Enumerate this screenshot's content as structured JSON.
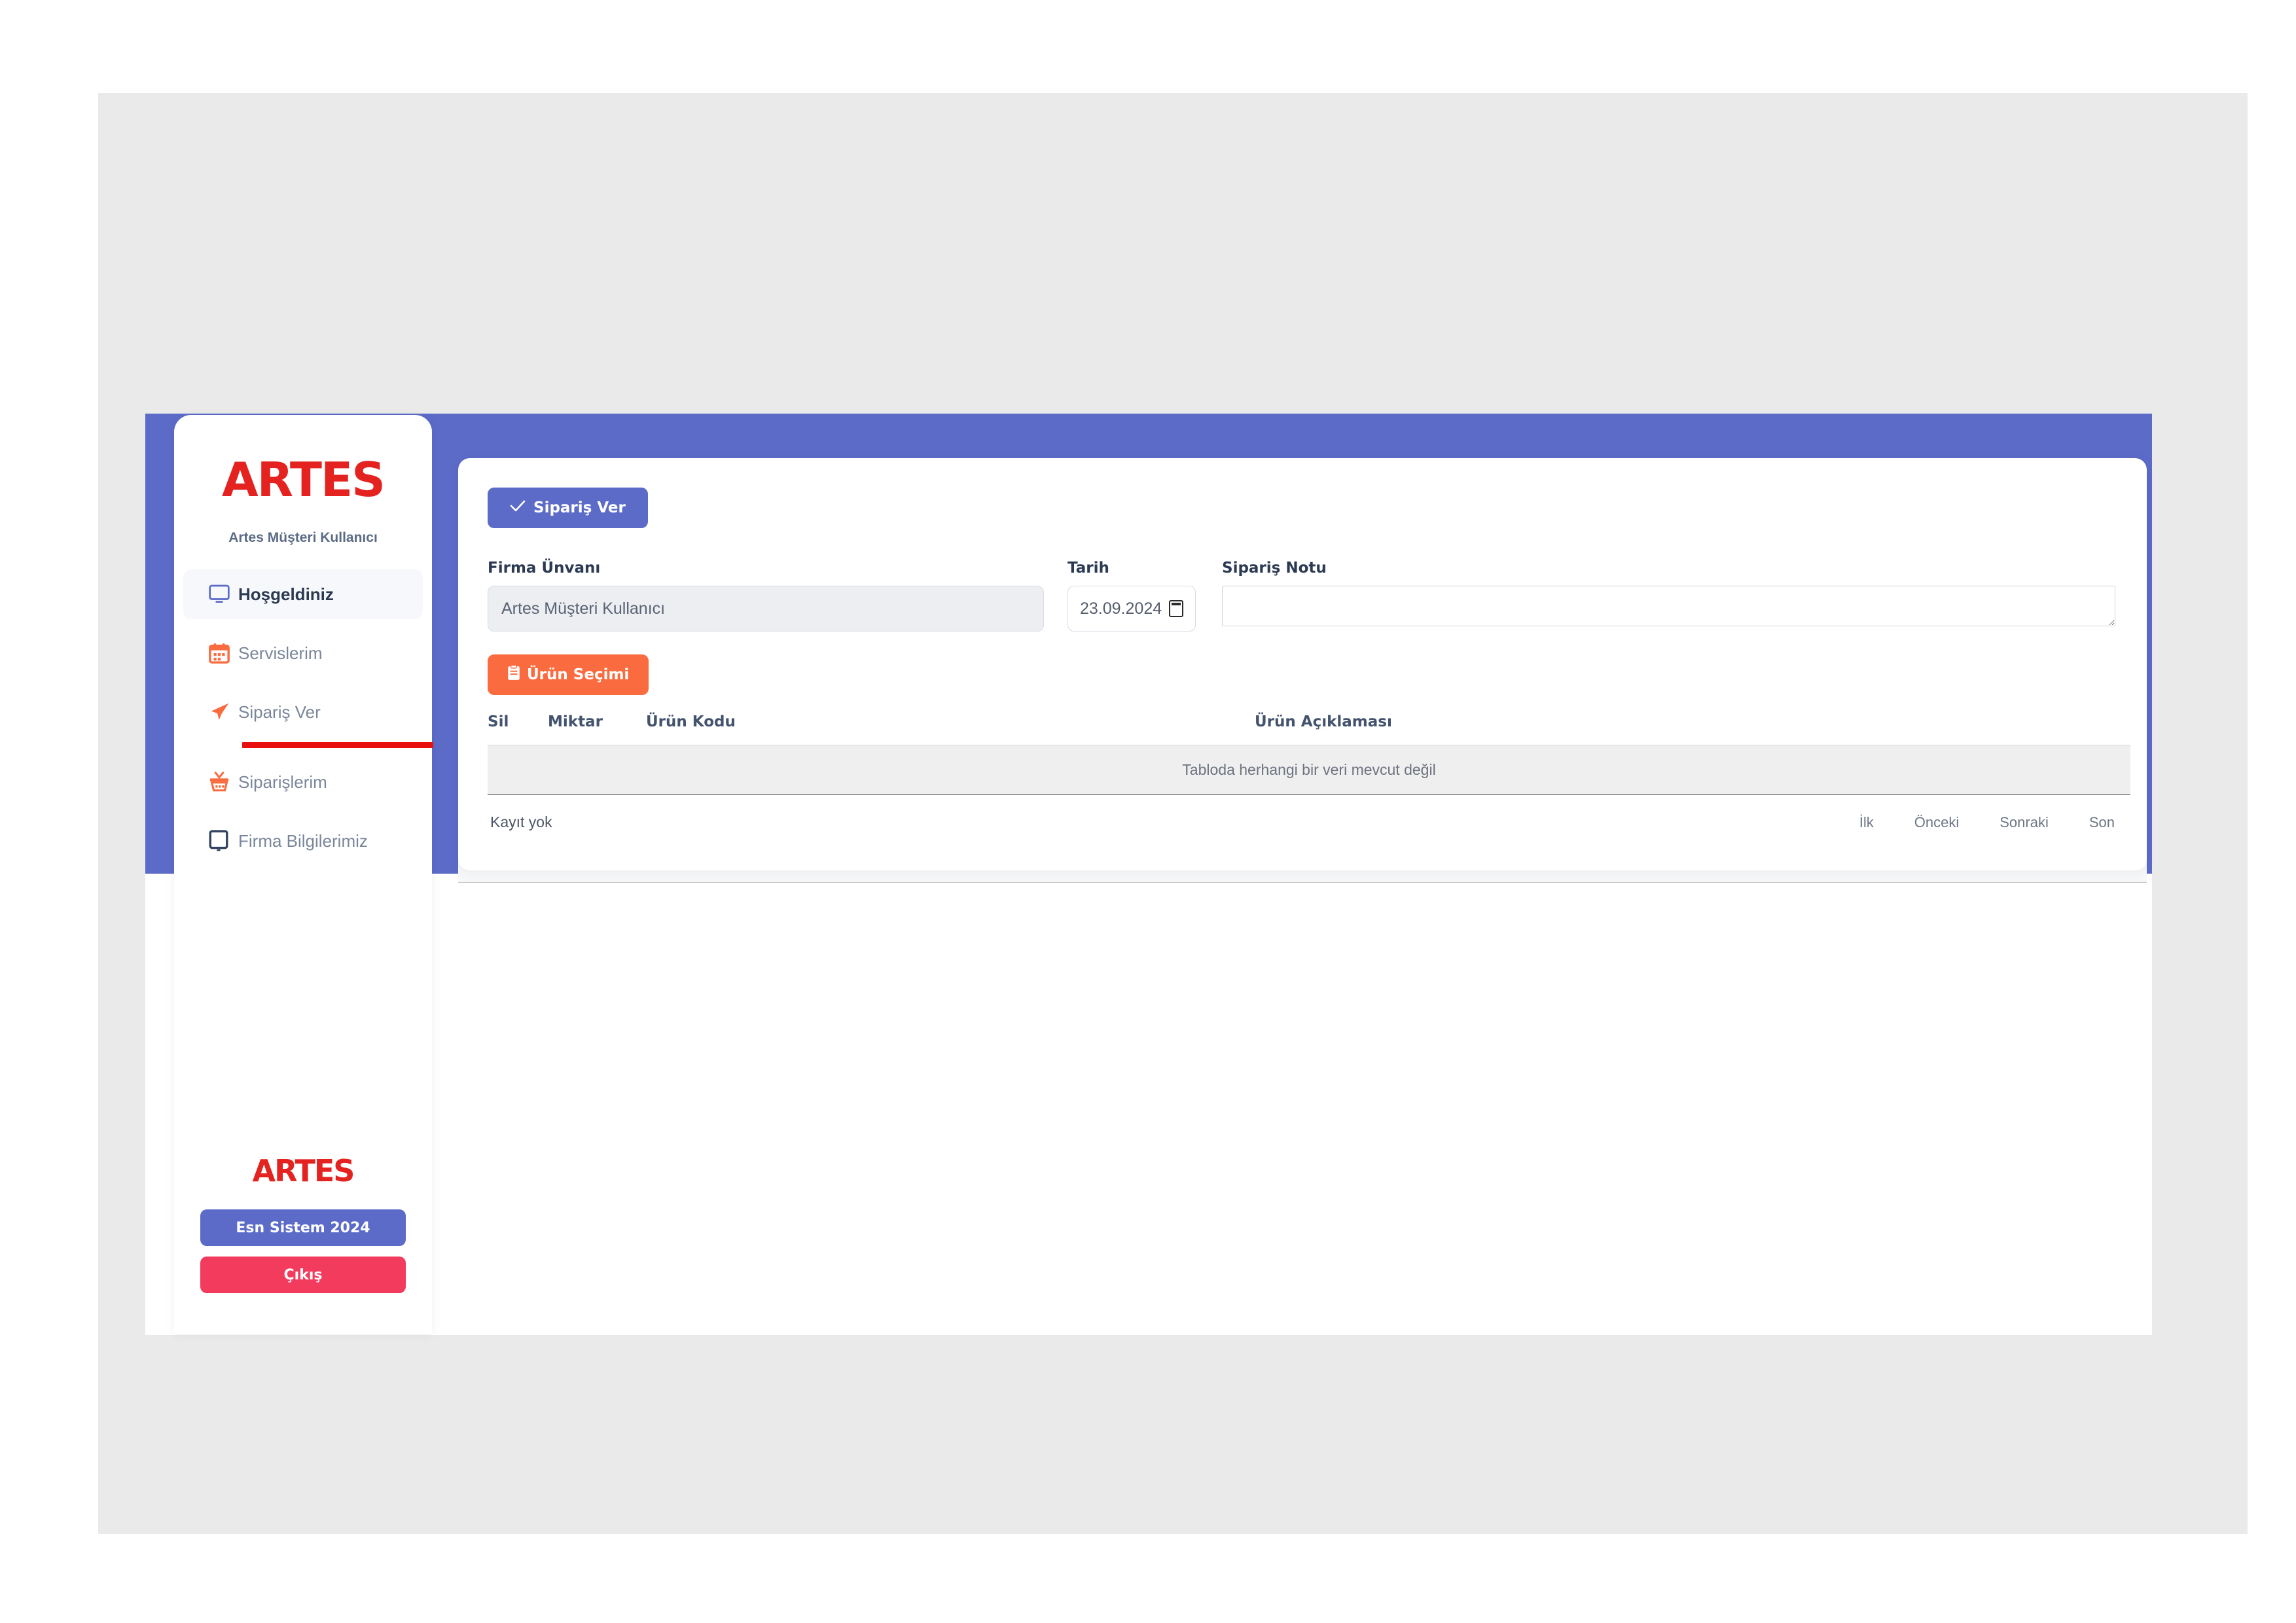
{
  "brand": {
    "logo_text": "ARTES",
    "logo_color": "#e42320",
    "footer_logo_text": "ARTES"
  },
  "colors": {
    "frame_purple": "#5c6bc8",
    "accent_orange": "#fa6b3f",
    "accent_red": "#e8100f",
    "logout_pink": "#f23b5d",
    "page_backdrop": "#eaeaea"
  },
  "sidebar": {
    "username": "Artes Müşteri Kullanıcı",
    "items": [
      {
        "label": "Hoşgeldiniz",
        "icon": "monitor-icon",
        "active": true
      },
      {
        "label": "Servislerim",
        "icon": "calendar-icon",
        "active": false
      },
      {
        "label": "Sipariş Ver",
        "icon": "paper-plane-icon",
        "active": false
      },
      {
        "label": "Siparişlerim",
        "icon": "basket-icon",
        "active": false
      },
      {
        "label": "Firma Bilgilerimiz",
        "icon": "tablet-icon",
        "active": false
      }
    ],
    "footer": {
      "system_button": "Esn Sistem 2024",
      "logout_button": "Çıkış"
    }
  },
  "main": {
    "submit_button": "Sipariş Ver",
    "submit_button_icon": "check-icon",
    "product_select_button": "Ürün Seçimi",
    "product_select_icon": "clipboard-icon",
    "fields": {
      "firma": {
        "label": "Firma Ünvanı",
        "value": "Artes Müşteri Kullanıcı",
        "placeholder": "Artes Müşteri Kullanıcı"
      },
      "tarih": {
        "label": "Tarih",
        "value": "23.09.2024",
        "icon": "calendar-icon"
      },
      "siparis_notu": {
        "label": "Sipariş Notu",
        "value": "",
        "placeholder": ""
      }
    },
    "table": {
      "headers": [
        "Sil",
        "Miktar",
        "Ürün Kodu",
        "Ürün Açıklaması"
      ],
      "rows": [],
      "empty_message": "Tabloda herhangi bir veri mevcut değil"
    },
    "pagination": {
      "count_text": "Kayıt yok",
      "links": [
        "İlk",
        "Önceki",
        "Sonraki",
        "Son"
      ]
    }
  }
}
